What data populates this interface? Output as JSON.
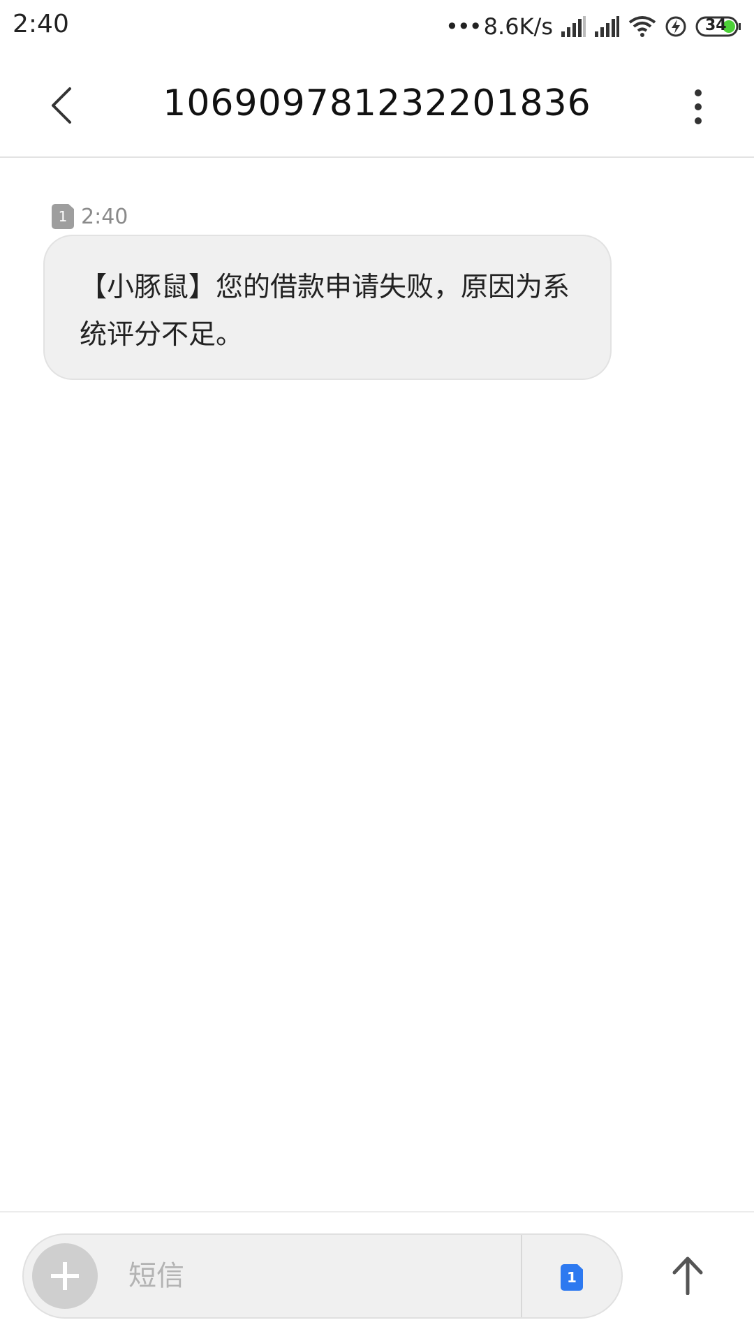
{
  "status_bar": {
    "time": "2:40",
    "net_dots": "•••",
    "net_speed": "8.6K/s",
    "battery_level": "34",
    "battery_color": "#4cd137"
  },
  "header": {
    "title": "10690978123220183 6",
    "back_icon": "chevron-left-icon",
    "menu_icon": "more-vertical-icon"
  },
  "message": {
    "sim_label": "1",
    "time": "2:40",
    "text": "【小豚鼠】您的借款申请失败，原因为系统评分不足。"
  },
  "composer": {
    "placeholder": "短信",
    "sim_label": "1",
    "sim_color": "#2d79f0"
  }
}
